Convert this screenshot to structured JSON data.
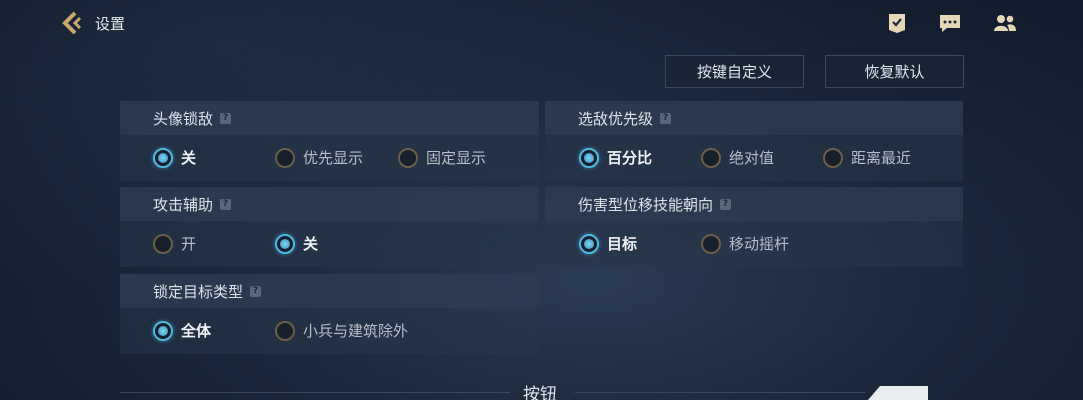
{
  "header": {
    "title": "设置"
  },
  "top_buttons": {
    "custom_keys": "按键自定义",
    "restore_default": "恢复默认"
  },
  "panels": [
    {
      "title": "头像锁敌",
      "options": [
        {
          "label": "关",
          "selected": true
        },
        {
          "label": "优先显示",
          "selected": false
        },
        {
          "label": "固定显示",
          "selected": false
        }
      ]
    },
    {
      "title": "选敌优先级",
      "options": [
        {
          "label": "百分比",
          "selected": true
        },
        {
          "label": "绝对值",
          "selected": false
        },
        {
          "label": "距离最近",
          "selected": false
        }
      ]
    },
    {
      "title": "攻击辅助",
      "options": [
        {
          "label": "开",
          "selected": false
        },
        {
          "label": "关",
          "selected": true
        }
      ]
    },
    {
      "title": "伤害型位移技能朝向",
      "options": [
        {
          "label": "目标",
          "selected": true
        },
        {
          "label": "移动摇杆",
          "selected": false
        }
      ]
    },
    {
      "title": "锁定目标类型",
      "options": [
        {
          "label": "全体",
          "selected": true
        },
        {
          "label": "小兵与建筑除外",
          "selected": false
        }
      ]
    }
  ],
  "help_glyph": "?",
  "section": {
    "title": "按钮"
  },
  "icons": {
    "back": "back-arrow-icon",
    "task": "task-badge-icon",
    "chat": "chat-icon",
    "friends": "friends-icon"
  },
  "colors": {
    "accent": "#4fb6de",
    "radio_border": "#6b5e49",
    "panel": "#28364b"
  }
}
